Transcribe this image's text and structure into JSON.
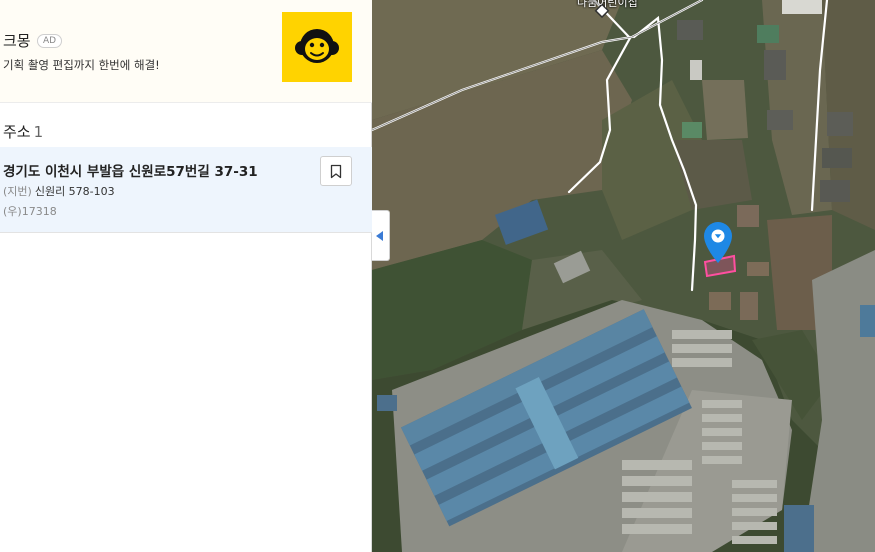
{
  "ad": {
    "title": "크몽",
    "badge": "AD",
    "description": "기획 촬영 편집까지 한번에 해결!",
    "logo_icon": "monkey-face-icon",
    "logo_bg": "#ffd300"
  },
  "results": {
    "heading": "주소",
    "count": "1",
    "items": [
      {
        "road_address": "경기도 이천시 부발읍 신원로57번길 37-31",
        "jibun_tag": "(지번)",
        "jibun_address": "신원리 578-103",
        "postal_tag": "(우)",
        "postal_code": "17318",
        "bookmark_icon": "bookmark-icon"
      }
    ]
  },
  "map": {
    "place_label": "나눔어린이집",
    "marker_color": "#1e88e5",
    "parcel_highlight_color": "#ff4fa0",
    "collapse_icon": "caret-left-icon"
  }
}
